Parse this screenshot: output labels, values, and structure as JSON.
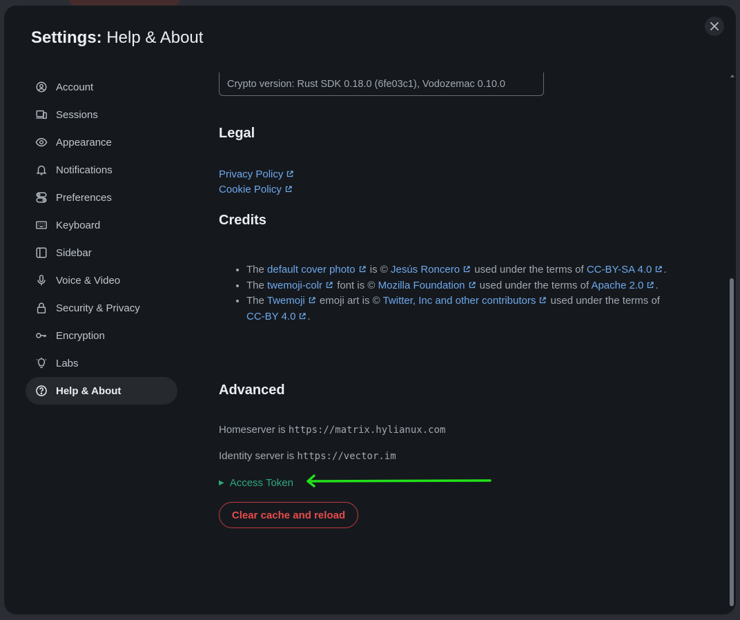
{
  "dialog": {
    "title_strong": "Settings:",
    "title_rest": "Help & About",
    "close_label": "✕"
  },
  "sidebar": {
    "items": [
      {
        "label": "Account",
        "icon": "account-icon"
      },
      {
        "label": "Sessions",
        "icon": "sessions-icon"
      },
      {
        "label": "Appearance",
        "icon": "eye-icon"
      },
      {
        "label": "Notifications",
        "icon": "bell-icon"
      },
      {
        "label": "Preferences",
        "icon": "toggle-icon"
      },
      {
        "label": "Keyboard",
        "icon": "keyboard-icon"
      },
      {
        "label": "Sidebar",
        "icon": "sidebar-icon"
      },
      {
        "label": "Voice & Video",
        "icon": "microphone-icon"
      },
      {
        "label": "Security & Privacy",
        "icon": "lock-icon"
      },
      {
        "label": "Encryption",
        "icon": "key-icon"
      },
      {
        "label": "Labs",
        "icon": "lightbulb-icon"
      },
      {
        "label": "Help & About",
        "icon": "help-icon",
        "active": true
      }
    ]
  },
  "crypto_version": "Crypto version: Rust SDK 0.18.0 (6fe03c1), Vodozemac 0.10.0",
  "legal": {
    "heading": "Legal",
    "links": [
      "Privacy Policy",
      "Cookie Policy"
    ]
  },
  "credits": {
    "heading": "Credits",
    "items": [
      {
        "t1": "The ",
        "l1": "default cover photo",
        "t2": " is © ",
        "l2": "Jesús Roncero",
        "t3": " used under the terms of ",
        "l3": "CC-BY-SA 4.0",
        "t4": "."
      },
      {
        "t1": "The ",
        "l1": "twemoji-colr",
        "t2": " font is © ",
        "l2": "Mozilla Foundation",
        "t3": " used under the terms of ",
        "l3": "Apache 2.0",
        "t4": "."
      },
      {
        "t1": "The ",
        "l1": "Twemoji",
        "t2": " emoji art is © ",
        "l2": "Twitter, Inc and other contributors",
        "t3": " used under the terms of ",
        "l3": "CC-BY 4.0",
        "t4": "."
      }
    ]
  },
  "advanced": {
    "heading": "Advanced",
    "homeserver_label": "Homeserver is ",
    "homeserver_url": "https://matrix.hylianux.com",
    "identity_label": "Identity server is ",
    "identity_url": "https://vector.im",
    "access_token": "Access Token",
    "clear_cache_button": "Clear cache and reload"
  },
  "colors": {
    "link": "#6fa8ea",
    "danger": "#e74b4b",
    "success": "#2fa77a",
    "annotation_arrow": "#22e01a"
  }
}
